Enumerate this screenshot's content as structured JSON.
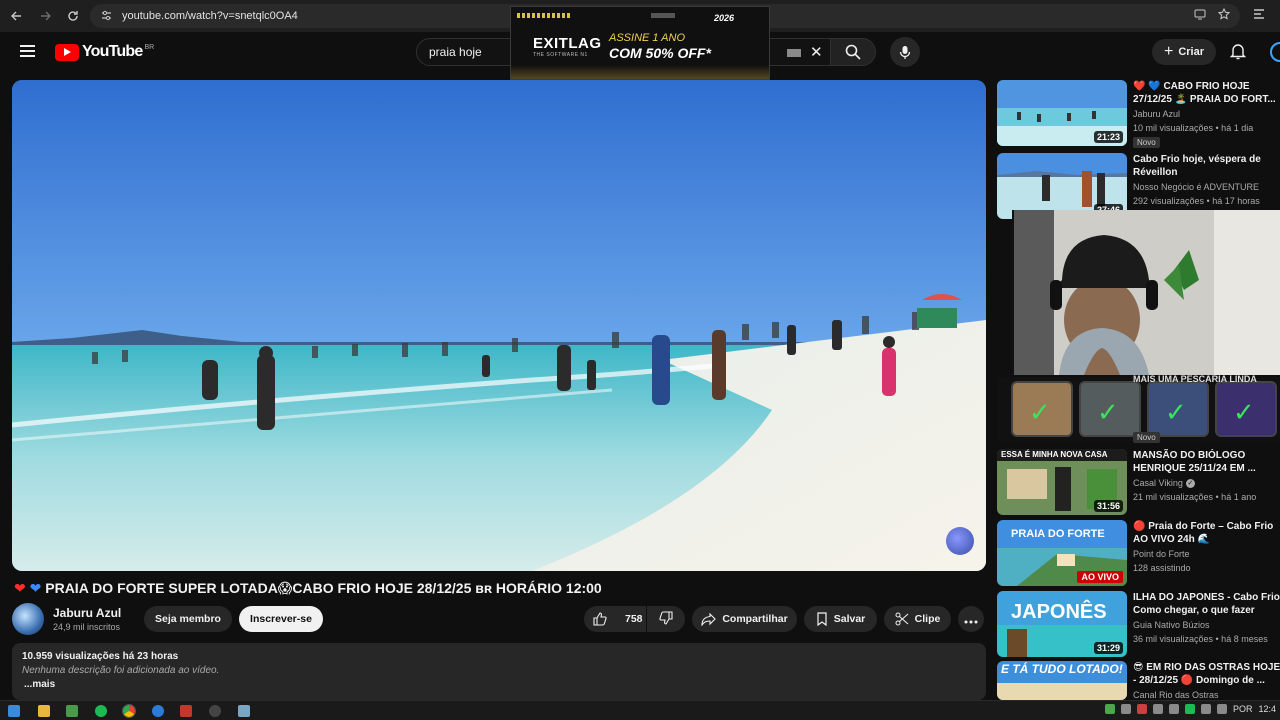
{
  "browser": {
    "url": "youtube.com/watch?v=snetqlc0OA4"
  },
  "ad": {
    "year": "2026",
    "brand": "EXITLAG",
    "brand_sub": "THE SOFTWARE N1",
    "line1": "ASSINE 1 ANO",
    "line2": "COM 50% OFF*"
  },
  "header": {
    "logo_text": "YouTube",
    "country": "BR",
    "search_value": "praia hoje",
    "create_label": "Criar"
  },
  "video": {
    "title_text": "PRAIA DO FORTE SUPER LOTADA😱CABO FRIO HOJE 28/12/25 ʙʀ HORÁRIO 12:00",
    "channel_name": "Jaburu Azul",
    "subscribers": "24,9 mil inscritos",
    "member_label": "Seja membro",
    "subscribe_label": "Inscrever-se",
    "likes": "758",
    "share_label": "Compartilhar",
    "save_label": "Salvar",
    "clip_label": "Clipe"
  },
  "description": {
    "stats": "10.959 visualizações  há 23 horas",
    "body": "Nenhuma descrição foi adicionada ao vídeo.",
    "more": "...mais"
  },
  "sidebar": {
    "items": [
      {
        "title1": "❤️ 💙 CABO FRIO HOJE",
        "title2": "27/12/25 🏝️ PRAIA DO FORT...",
        "channel": "Jaburu Azul",
        "meta": "10 mil visualizações  • há 1 dia",
        "badge": "Novo",
        "duration": "21:23"
      },
      {
        "title1": "Cabo Frio hoje, véspera de",
        "title2": "Réveillon",
        "channel": "Nosso Negócio é ADVENTURE",
        "meta": "292 visualizações  • há 17 horas",
        "duration": "27:46"
      },
      {
        "title1": "MAIS UMA PESCARIA LINDA",
        "badge": "Novo"
      },
      {
        "title1": "MANSÃO DO BIÓLOGO",
        "title2": "HENRIQUE 25/11/24 EM ...",
        "channel": "Casal Viking",
        "meta": "21 mil visualizações  • há 1 ano",
        "duration": "31:56",
        "thumb_text": "ESSA É MINHA NOVA CASA"
      },
      {
        "title1": "🔴 Praia do Forte – Cabo Frio",
        "title2": "AO VIVO 24h 🌊",
        "channel": "Point do Forte",
        "meta": "128 assistindo",
        "live": "AO VIVO",
        "thumb_text": "PRAIA DO FORTE"
      },
      {
        "title1": "ILHA DO JAPONES - Cabo Frio",
        "title2": "Como chegar, o que fazer",
        "channel": "Guia Nativo Búzios",
        "meta": "36 mil visualizações  • há 8 meses",
        "duration": "31:29",
        "thumb_text": "JAPONÊS"
      },
      {
        "title1": "😎 EM RIO DAS OSTRAS HOJE",
        "title2": "- 28/12/25 🔴 Domingo de ...",
        "channel": "Canal Rio das Ostras",
        "thumb_text": "E TÁ TUDO LOTADO!"
      }
    ]
  },
  "taskbar": {
    "lang": "POR",
    "clock": "12:4"
  }
}
